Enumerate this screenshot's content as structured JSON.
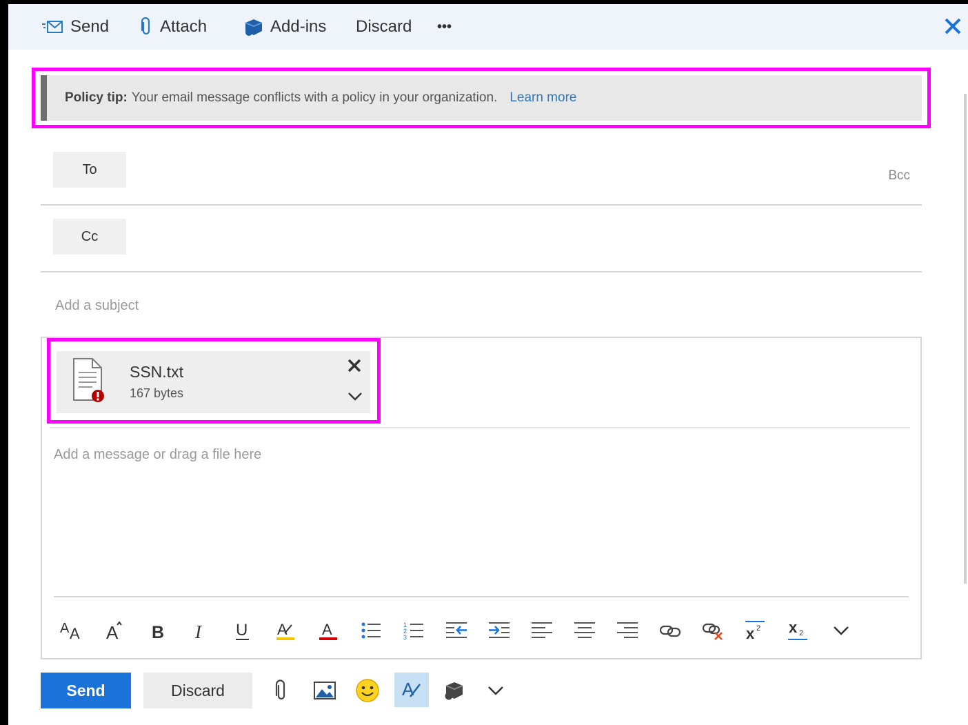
{
  "toolbar": {
    "send_label": "Send",
    "attach_label": "Attach",
    "addins_label": "Add-ins",
    "discard_label": "Discard",
    "more_label": "•••"
  },
  "policy_tip": {
    "prefix": "Policy tip:",
    "message": "Your email message conflicts with a policy in your organization.",
    "link_label": "Learn more"
  },
  "recipients": {
    "to_label": "To",
    "cc_label": "Cc",
    "bcc_label": "Bcc"
  },
  "subject": {
    "placeholder": "Add a subject",
    "value": ""
  },
  "attachment": {
    "file_name": "SSN.txt",
    "file_size": "167 bytes"
  },
  "message": {
    "placeholder": "Add a message or drag a file here",
    "value": ""
  },
  "format_toolbar": {
    "icons": [
      "font-size-icon",
      "grow-font-icon",
      "bold-icon",
      "italic-icon",
      "underline-icon",
      "highlight-icon",
      "font-color-icon",
      "bullets-icon",
      "numbering-icon",
      "decrease-indent-icon",
      "increase-indent-icon",
      "align-left-icon",
      "align-center-icon",
      "align-right-icon",
      "insert-link-icon",
      "remove-link-icon",
      "superscript-icon",
      "subscript-icon",
      "more-options-chevron-icon"
    ]
  },
  "actions": {
    "send_label": "Send",
    "discard_label": "Discard"
  },
  "colors": {
    "accent": "#1a73d8",
    "highlight_outline": "#ff00ff",
    "link": "#2b79c2",
    "error": "#c00000"
  }
}
